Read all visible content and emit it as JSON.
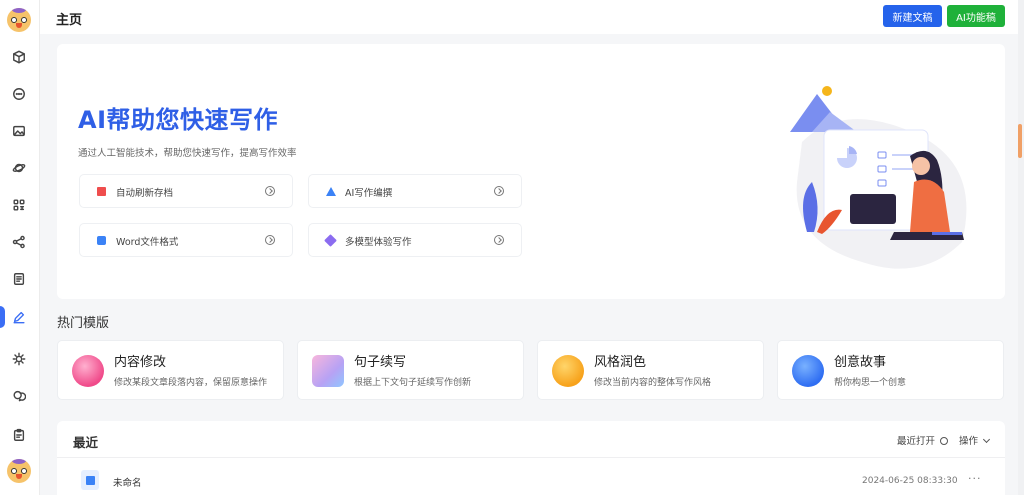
{
  "header": {
    "title": "主页",
    "new_doc_label": "新建文稿",
    "ai_label": "AI功能稿"
  },
  "sidebar": {
    "items": [
      {
        "name": "cube-icon"
      },
      {
        "name": "chat-icon"
      },
      {
        "name": "image-icon"
      },
      {
        "name": "planet-icon"
      },
      {
        "name": "grid-icon"
      },
      {
        "name": "share-icon"
      },
      {
        "name": "document-icon"
      },
      {
        "name": "pen-icon",
        "active": true
      },
      {
        "name": "sun-icon"
      },
      {
        "name": "message-icon"
      },
      {
        "name": "clipboard-icon"
      }
    ]
  },
  "hero": {
    "title": "AI帮助您快速写作",
    "subtitle": "通过人工智能技术，帮助您快速写作，提高写作效率",
    "features": [
      {
        "label": "自动刷新存档",
        "icon": "pin-icon",
        "color": "#ef4d4d"
      },
      {
        "label": "AI写作编撰",
        "icon": "triangle-icon",
        "color": "#3b82f6"
      },
      {
        "label": "Word文件格式",
        "icon": "word-icon",
        "color": "#3b82f6"
      },
      {
        "label": "多模型体验写作",
        "icon": "cube-icon",
        "color": "#8b6cf0"
      }
    ]
  },
  "templates": {
    "heading": "热门模版",
    "items": [
      {
        "title": "内容修改",
        "desc": "修改某段文章段落内容，保留原意操作",
        "color": "#f04a8a"
      },
      {
        "title": "句子续写",
        "desc": "根据上下文句子延续写作创新",
        "color": "#b7a2f4"
      },
      {
        "title": "风格润色",
        "desc": "修改当前内容的整体写作风格",
        "color": "#f7a21b"
      },
      {
        "title": "创意故事",
        "desc": "帮你构思一个创意",
        "color": "#2f6ef2"
      }
    ]
  },
  "recent": {
    "title": "最近",
    "sort_label": "最近打开",
    "ops_label": "操作",
    "rows": [
      {
        "name": "未命名",
        "date": "2024-06-25 08:33:30"
      }
    ]
  }
}
